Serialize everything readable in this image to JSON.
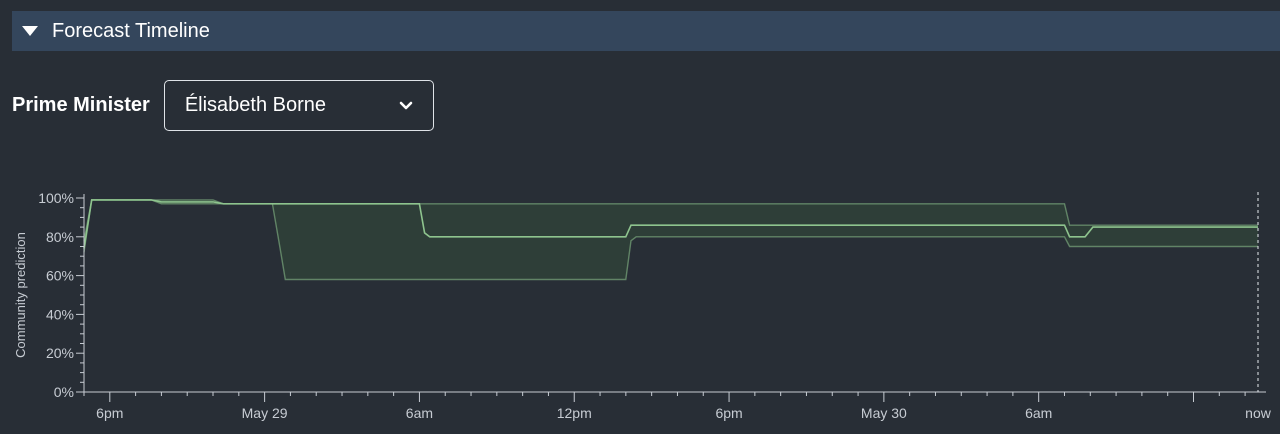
{
  "header": {
    "title": "Forecast Timeline",
    "toggle_icon": "caret-down-icon"
  },
  "selector": {
    "label": "Prime Minister",
    "selected": "Élisabeth Borne",
    "icon": "chevron-down-icon"
  },
  "colors": {
    "background": "#282e36",
    "header_bg": "#34465c",
    "line": "#8ec48e",
    "band_fill": "#2f4138",
    "axis": "#c7ccd3"
  },
  "chart_data": {
    "type": "area",
    "ylabel": "Community prediction",
    "ylim": [
      0,
      100
    ],
    "y_ticks": [
      "0%",
      "20%",
      "40%",
      "60%",
      "80%",
      "100%"
    ],
    "x_ticks": [
      "6pm",
      "May 29",
      "6am",
      "12pm",
      "6pm",
      "May 30",
      "6am",
      "now"
    ],
    "x_tick_hours": [
      18,
      24,
      30,
      36,
      42,
      48,
      54,
      62.5
    ],
    "x_range_hours": [
      17,
      62.5
    ],
    "series": [
      {
        "role": "median",
        "points": [
          [
            17,
            74
          ],
          [
            17.3,
            99
          ],
          [
            19.6,
            99
          ],
          [
            20,
            98
          ],
          [
            22,
            98
          ],
          [
            22.4,
            97
          ],
          [
            30,
            97
          ],
          [
            30.2,
            82
          ],
          [
            30.4,
            80
          ],
          [
            38,
            80
          ],
          [
            38.2,
            86
          ],
          [
            55,
            86
          ],
          [
            55.2,
            80
          ],
          [
            55.8,
            80
          ],
          [
            56.1,
            85
          ],
          [
            62.5,
            85
          ]
        ]
      },
      {
        "role": "upper",
        "points": [
          [
            17,
            78
          ],
          [
            17.3,
            99
          ],
          [
            22,
            99
          ],
          [
            22.4,
            97
          ],
          [
            55,
            97
          ],
          [
            55.2,
            86
          ],
          [
            62.5,
            86
          ]
        ]
      },
      {
        "role": "lower",
        "points": [
          [
            17,
            72
          ],
          [
            17.3,
            99
          ],
          [
            19.6,
            99
          ],
          [
            20,
            97
          ],
          [
            24.3,
            97
          ],
          [
            24.6,
            74
          ],
          [
            24.8,
            58
          ],
          [
            38,
            58
          ],
          [
            38.2,
            78
          ],
          [
            38.4,
            80
          ],
          [
            55,
            80
          ],
          [
            55.2,
            75
          ],
          [
            62.5,
            75
          ]
        ]
      }
    ]
  }
}
